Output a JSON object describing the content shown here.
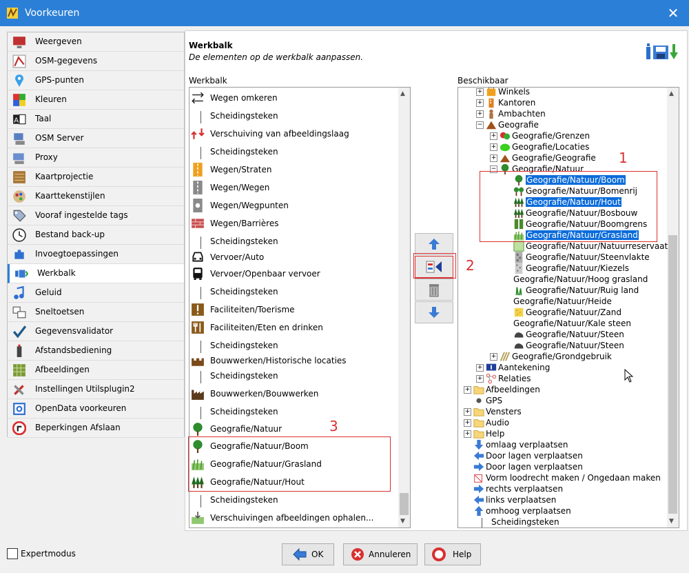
{
  "window": {
    "title": "Voorkeuren",
    "close": "✕"
  },
  "sidebar": {
    "items": [
      {
        "label": "Weergeven",
        "icon": "display-icon"
      },
      {
        "label": "OSM-gegevens",
        "icon": "osm-data-icon"
      },
      {
        "label": "GPS-punten",
        "icon": "gps-pin-icon"
      },
      {
        "label": "Kleuren",
        "icon": "colors-icon"
      },
      {
        "label": "Taal",
        "icon": "language-icon"
      },
      {
        "label": "OSM Server",
        "icon": "server-icon"
      },
      {
        "label": "Proxy",
        "icon": "proxy-icon"
      },
      {
        "label": "Kaartprojectie",
        "icon": "projection-icon"
      },
      {
        "label": "Kaarttekenstijlen",
        "icon": "map-style-icon"
      },
      {
        "label": "Vooraf ingestelde tags",
        "icon": "tag-icon"
      },
      {
        "label": "Bestand back-up",
        "icon": "backup-clock-icon"
      },
      {
        "label": "Invoegtoepassingen",
        "icon": "plugin-icon"
      },
      {
        "label": "Werkbalk",
        "icon": "toolbar-icon",
        "selected": true
      },
      {
        "label": "Geluid",
        "icon": "sound-icon"
      },
      {
        "label": "Sneltoetsen",
        "icon": "shortcut-icon"
      },
      {
        "label": "Gegevensvalidator",
        "icon": "validator-check-icon"
      },
      {
        "label": "Afstandsbediening",
        "icon": "remote-icon"
      },
      {
        "label": "Afbeeldingen",
        "icon": "imagery-grid-icon"
      },
      {
        "label": "Instellingen Utilsplugin2",
        "icon": "tools-icon"
      },
      {
        "label": "OpenData voorkeuren",
        "icon": "opendata-icon"
      },
      {
        "label": "Beperkingen Afslaan",
        "icon": "turn-restriction-icon"
      }
    ]
  },
  "panel": {
    "title": "Werkbalk",
    "description": "De elementen op de werkbalk aanpassen.",
    "left_label": "Werkbalk",
    "right_label": "Beschikbaar"
  },
  "toolbar_list": [
    {
      "label": "Wegen omkeren",
      "icon": "reverse-way-icon"
    },
    {
      "label": "Scheidingsteken",
      "icon": "separator-icon"
    },
    {
      "label": "Verschuiving van afbeeldingslaag",
      "icon": "imagery-offset-icon"
    },
    {
      "label": "Scheidingsteken",
      "icon": "separator-icon"
    },
    {
      "label": "Wegen/Straten",
      "icon": "street-icon"
    },
    {
      "label": "Wegen/Wegen",
      "icon": "road-icon"
    },
    {
      "label": "Wegen/Wegpunten",
      "icon": "waypoint-icon"
    },
    {
      "label": "Wegen/Barrières",
      "icon": "barrier-wall-icon"
    },
    {
      "label": "Scheidingsteken",
      "icon": "separator-icon"
    },
    {
      "label": "Vervoer/Auto",
      "icon": "car-icon"
    },
    {
      "label": "Vervoer/Openbaar vervoer",
      "icon": "bus-icon"
    },
    {
      "label": "Scheidingsteken",
      "icon": "separator-icon"
    },
    {
      "label": "Faciliteiten/Toerisme",
      "icon": "tourism-icon"
    },
    {
      "label": "Faciliteiten/Eten en drinken",
      "icon": "food-icon"
    },
    {
      "label": "Scheidingsteken",
      "icon": "separator-icon"
    },
    {
      "label": "Bouwwerken/Historische locaties",
      "icon": "castle-icon"
    },
    {
      "label": "Scheidingsteken",
      "icon": "separator-icon"
    },
    {
      "label": "Bouwwerken/Bouwwerken",
      "icon": "factory-icon"
    },
    {
      "label": "Scheidingsteken",
      "icon": "separator-icon"
    },
    {
      "label": "Geografie/Natuur",
      "icon": "tree-icon"
    },
    {
      "label": "Geografie/Natuur/Boom",
      "icon": "tree-icon"
    },
    {
      "label": "Geografie/Natuur/Grasland",
      "icon": "grass-icon"
    },
    {
      "label": "Geografie/Natuur/Hout",
      "icon": "forest-icon"
    },
    {
      "label": "Scheidingsteken",
      "icon": "separator-icon"
    },
    {
      "label": "Verschuivingen afbeeldingen ophalen...",
      "icon": "imagery-download-icon"
    }
  ],
  "buttons": {
    "up": "move-up-icon",
    "add": "add-to-toolbar-icon",
    "delete": "trash-icon",
    "down": "move-down-icon"
  },
  "tree": [
    {
      "label": "Winkels",
      "level": 1,
      "expand": "+",
      "icon": "shop-icon"
    },
    {
      "label": "Kantoren",
      "level": 1,
      "expand": "+",
      "icon": "office-icon"
    },
    {
      "label": "Ambachten",
      "level": 1,
      "expand": "+",
      "icon": "craft-icon"
    },
    {
      "label": "Geografie",
      "level": 1,
      "expand": "-",
      "icon": "geography-icon"
    },
    {
      "label": "Geografie/Grenzen",
      "level": 2,
      "expand": "+",
      "icon": "borders-icon"
    },
    {
      "label": "Geografie/Locaties",
      "level": 2,
      "expand": "+",
      "icon": "locations-icon"
    },
    {
      "label": "Geografie/Geografie",
      "level": 2,
      "expand": "+",
      "icon": "mountain-icon"
    },
    {
      "label": "Geografie/Natuur",
      "level": 2,
      "expand": "-",
      "icon": "tree-icon"
    },
    {
      "label": "Geografie/Natuur/Boom",
      "level": 3,
      "icon": "tree-icon",
      "highlight": true
    },
    {
      "label": "Geografie/Natuur/Bomenrij",
      "level": 3,
      "icon": "tree-row-icon"
    },
    {
      "label": "Geografie/Natuur/Hout",
      "level": 3,
      "icon": "forest-icon",
      "highlight": true
    },
    {
      "label": "Geografie/Natuur/Bosbouw",
      "level": 3,
      "icon": "forest-icon"
    },
    {
      "label": "Geografie/Natuur/Boomgrens",
      "level": 3,
      "icon": "tree-line-icon"
    },
    {
      "label": "Geografie/Natuur/Grasland",
      "level": 3,
      "icon": "grass-icon",
      "highlight": true
    },
    {
      "label": "Geografie/Natuur/Natuurreservaat",
      "level": 3,
      "icon": "reserve-icon"
    },
    {
      "label": "Geografie/Natuur/Steenvlakte",
      "level": 3,
      "icon": "scree-icon"
    },
    {
      "label": "Geografie/Natuur/Kiezels",
      "level": 3,
      "icon": "shingle-icon"
    },
    {
      "label": "Geografie/Natuur/Hoog grasland",
      "level": 3,
      "icon": "none"
    },
    {
      "label": "Geografie/Natuur/Ruig land",
      "level": 3,
      "icon": "scrub-icon"
    },
    {
      "label": "Geografie/Natuur/Heide",
      "level": 3,
      "icon": "none"
    },
    {
      "label": "Geografie/Natuur/Zand",
      "level": 3,
      "icon": "sand-icon"
    },
    {
      "label": "Geografie/Natuur/Kale steen",
      "level": 3,
      "icon": "none"
    },
    {
      "label": "Geografie/Natuur/Steen",
      "level": 3,
      "icon": "stone-icon"
    },
    {
      "label": "Geografie/Natuur/Steen",
      "level": 3,
      "icon": "stone-icon"
    },
    {
      "label": "Geografie/Grondgebruik",
      "level": 2,
      "expand": "+",
      "icon": "landuse-icon"
    },
    {
      "label": "Aantekening",
      "level": 1,
      "expand": "+",
      "icon": "annotation-icon"
    },
    {
      "label": "Relaties",
      "level": 1,
      "expand": "+",
      "icon": "relation-icon"
    },
    {
      "label": "Afbeeldingen",
      "level": 0,
      "expand": "+",
      "icon": "folder-icon"
    },
    {
      "label": "GPS",
      "level": 0,
      "icon": "dot-icon"
    },
    {
      "label": "Vensters",
      "level": 0,
      "expand": "+",
      "icon": "folder-icon"
    },
    {
      "label": "Audio",
      "level": 0,
      "expand": "+",
      "icon": "folder-icon"
    },
    {
      "label": "Help",
      "level": 0,
      "expand": "+",
      "icon": "folder-icon"
    },
    {
      "label": "omlaag verplaatsen",
      "level": 0,
      "icon": "arrow-down-icon"
    },
    {
      "label": "Door lagen verplaatsen",
      "level": 0,
      "icon": "arrow-left-icon"
    },
    {
      "label": "Door lagen verplaatsen",
      "level": 0,
      "icon": "arrow-right-icon"
    },
    {
      "label": "Vorm loodrecht maken / Ongedaan maken",
      "level": 0,
      "icon": "orthogonal-icon"
    },
    {
      "label": "rechts verplaatsen",
      "level": 0,
      "icon": "arrow-right-icon"
    },
    {
      "label": "links verplaatsen",
      "level": 0,
      "icon": "arrow-left-icon"
    },
    {
      "label": "omhoog verplaatsen",
      "level": 0,
      "icon": "arrow-up-icon"
    },
    {
      "label": "Scheidingsteken",
      "level": 0,
      "icon": "separator-icon"
    }
  ],
  "annotations": {
    "one": "1",
    "two": "2",
    "three": "3"
  },
  "footer": {
    "expert": "Expertmodus",
    "ok": "OK",
    "cancel": "Annuleren",
    "help": "Help"
  },
  "colors": {
    "titlebar": "#2c7fd6",
    "selection": "#0b6cda",
    "annotation": "#d93030"
  }
}
